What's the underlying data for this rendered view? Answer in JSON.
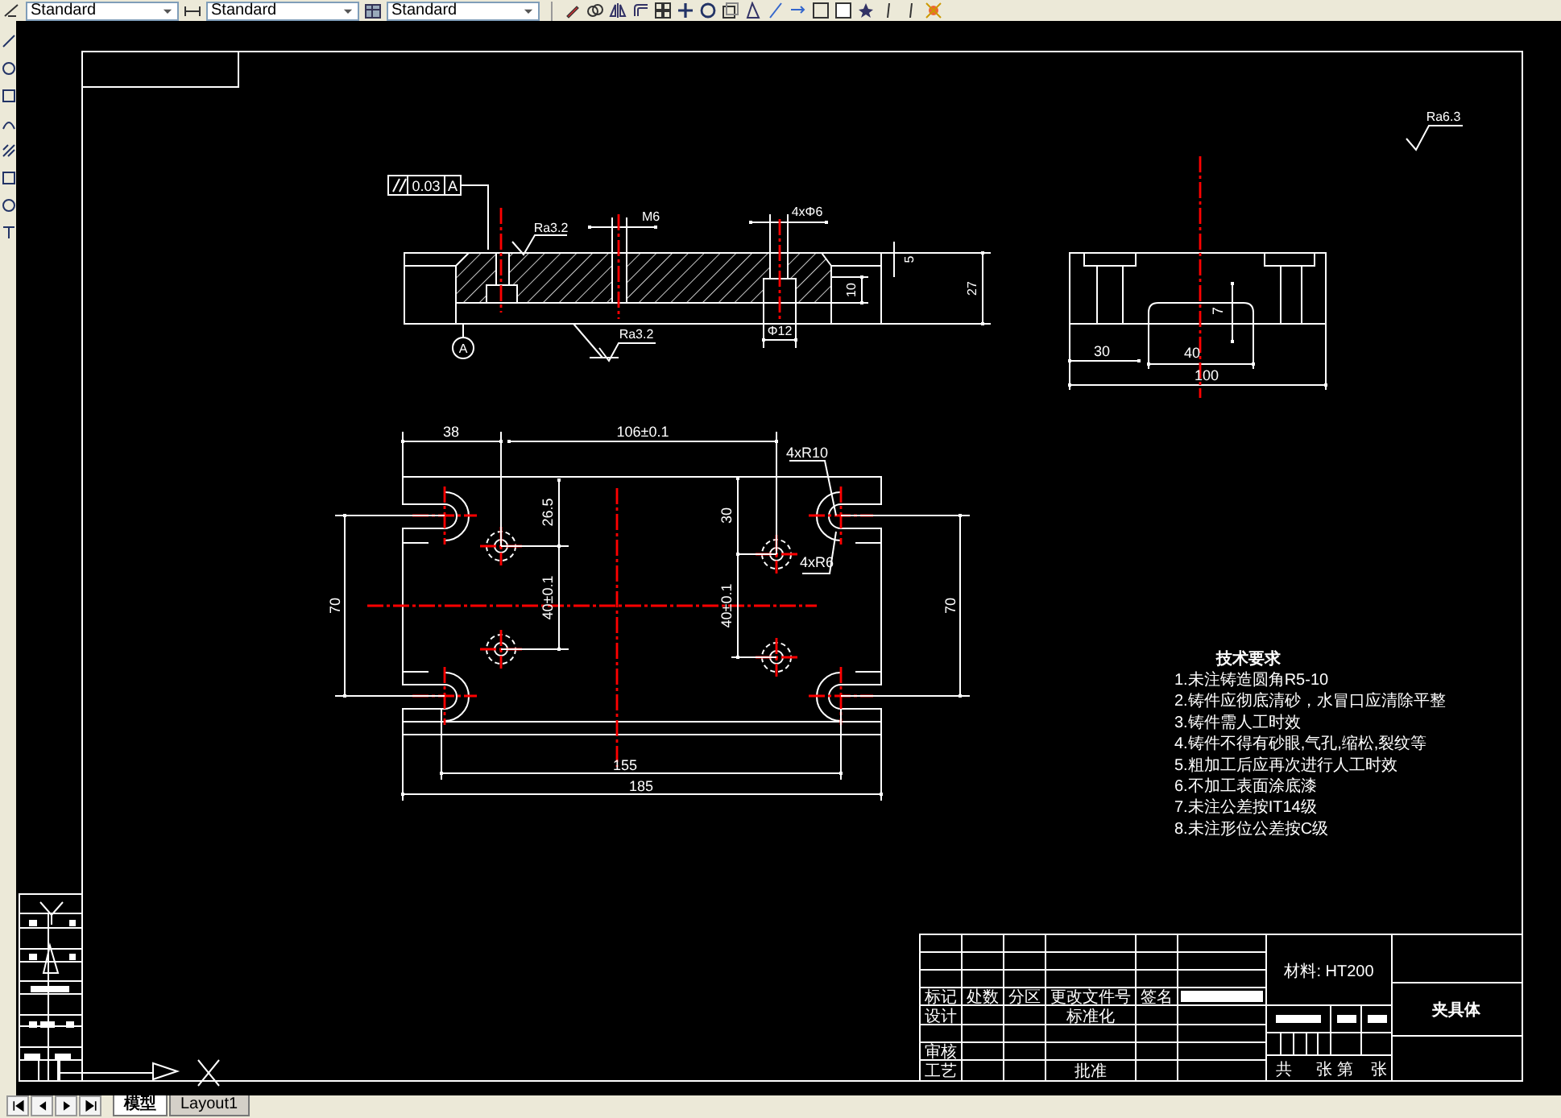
{
  "toolbar": {
    "style_selects": [
      {
        "value": "Standard"
      },
      {
        "value": "Standard"
      },
      {
        "value": "Standard"
      }
    ]
  },
  "drawing": {
    "roughness_note": "Ra6.3",
    "tolerance_frame": {
      "value": "0.03",
      "datum": "A"
    },
    "section_view_labels": [
      "Ra3.2",
      "M6",
      "4xΦ6",
      "5",
      "27",
      "10",
      "Φ12",
      "A",
      "Ra3.2"
    ],
    "side_view_labels": [
      "30",
      "40",
      "100",
      "7"
    ],
    "top_view_labels": [
      "38",
      "106±0.1",
      "4xR10",
      "26.5",
      "30",
      "4xR6",
      "40±0.1",
      "40±0.1",
      "70",
      "70",
      "155",
      "185"
    ],
    "technical_requirements": {
      "title": "技术要求",
      "items": [
        "1.未注铸造圆角R5-10",
        "2.铸件应彻底清砂，水冒口应清除平整",
        "3.铸件需人工时效",
        "4.铸件不得有砂眼,气孔,缩松,裂纹等",
        "5.粗加工后应再次进行人工时效",
        "6.不加工表面涂底漆",
        "7.未注公差按IT14级",
        "8.未注形位公差按C级"
      ]
    },
    "title_block": {
      "material": "材料: HT200",
      "part_name": "夹具体",
      "labels": [
        "标记",
        "处数",
        "分区",
        "更改文件号",
        "签名",
        "设计",
        "标准化",
        "审核",
        "工艺",
        "批准",
        "共",
        "张",
        "第",
        "张"
      ]
    }
  },
  "layout_tabs": [
    {
      "label": "模型",
      "selected": true
    },
    {
      "label": "Layout1",
      "selected": false
    }
  ]
}
